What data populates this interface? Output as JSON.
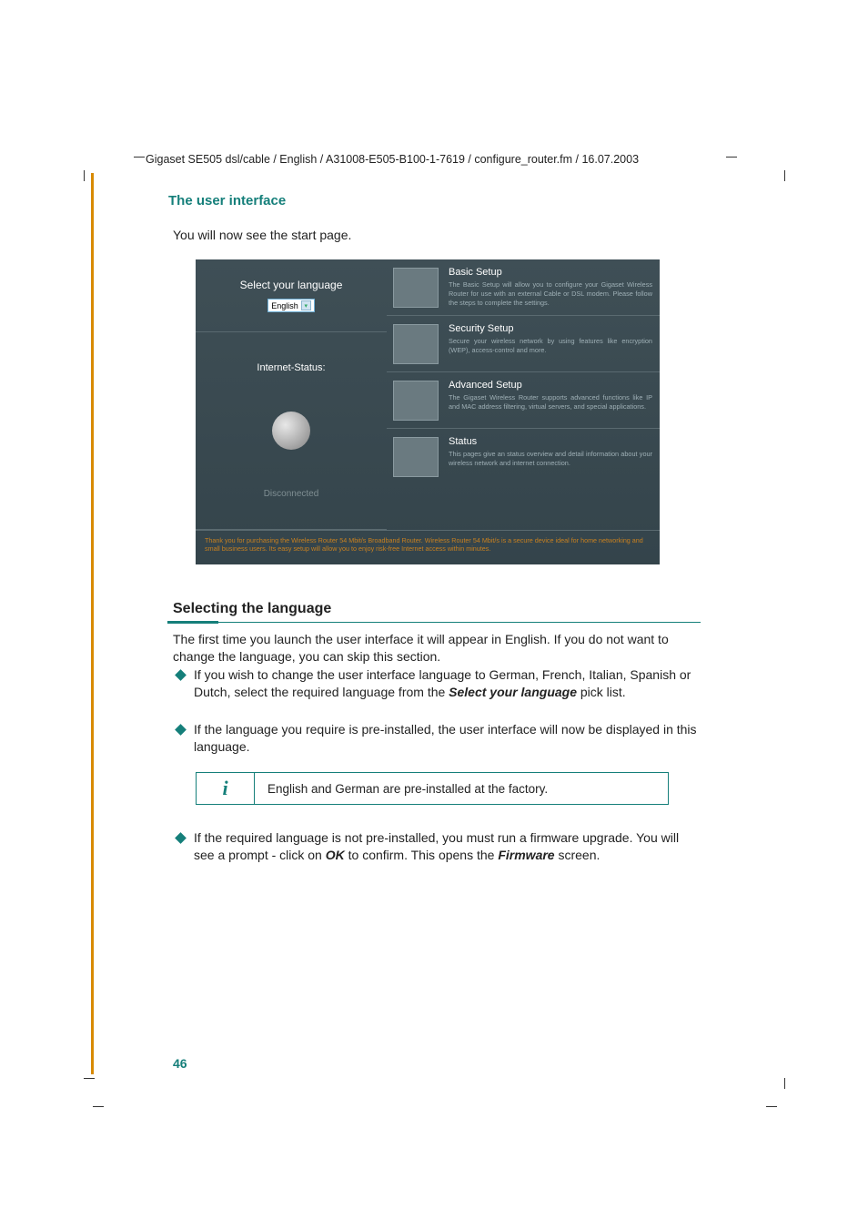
{
  "header_path": "Gigaset SE505 dsl/cable / English / A31008-E505-B100-1-7619 / configure_router.fm / 16.07.2003",
  "section_title": "The user interface",
  "intro": "You will now see the start page.",
  "screenshot": {
    "lang_label": "Select your language",
    "lang_select_value": "English",
    "status_label": "Internet-Status:",
    "status_value": "Disconnected",
    "cards": [
      {
        "title": "Basic Setup",
        "desc": "The Basic Setup will allow you to configure your Gigaset Wireless Router for use with an external Cable or DSL modem. Please follow the steps to complete the settings."
      },
      {
        "title": "Security Setup",
        "desc": "Secure your wireless network by using features like encryption (WEP), access-control and more."
      },
      {
        "title": "Advanced Setup",
        "desc": "The Gigaset Wireless Router supports advanced functions like IP and MAC address filtering, virtual servers, and special applications."
      },
      {
        "title": "Status",
        "desc": "This pages give an status overview and detail information about your wireless network and internet connection."
      }
    ],
    "footer": "Thank you for purchasing the Wireless Router 54 Mbit/s Broadband Router. Wireless Router 54 Mbit/s is a secure device ideal for home networking and small business users. Its easy setup will allow you to enjoy risk-free Internet access within minutes."
  },
  "h2": "Selecting the language",
  "p1": "The first time you launch the user interface it will appear in English. If you do not want to change the language, you can skip this section.",
  "bullets1": {
    "pre": "If you wish to change the user interface language to German, French, Italian, Spanish or Dutch, select the required language from the ",
    "bold": "Select your language",
    "post": " pick list."
  },
  "bullets2": "If the language you require is pre-installed, the user interface will now be displayed in this language.",
  "info_glyph": "i",
  "info_text": "English and German are pre-installed at the factory.",
  "bullets3": {
    "pre": "If the required language is not pre-installed, you must run a firmware upgrade. You will see a prompt - click on ",
    "ok": "OK",
    "mid": " to confirm. This opens the ",
    "fw": "Firmware",
    "post": " screen."
  },
  "page_number": "46"
}
